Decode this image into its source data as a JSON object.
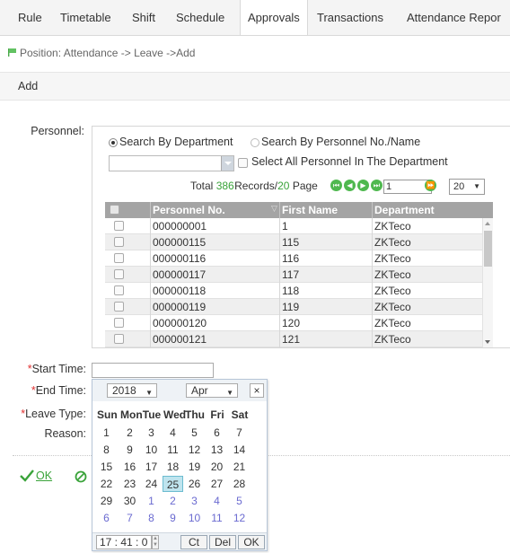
{
  "nav": {
    "tabs": [
      {
        "label": "Rule"
      },
      {
        "label": "Timetable"
      },
      {
        "label": "Shift"
      },
      {
        "label": "Schedule"
      },
      {
        "label": "Approvals",
        "active": true
      },
      {
        "label": "Transactions"
      },
      {
        "label": "Attendance Repor"
      }
    ]
  },
  "breadcrumb": "Position: Attendance -> Leave ->Add",
  "toolbar": {
    "title": "Add"
  },
  "form": {
    "personnel_label": "Personnel:",
    "search_by_department": "Search By Department",
    "search_by_personnel": "Search By Personnel No./Name",
    "select_all_label": "Select All Personnel In The Department",
    "department_value": "",
    "pager": {
      "total_prefix": "Total",
      "total": "386",
      "records_mid": "Records/",
      "pages": "20",
      "page_word": "Page",
      "current_page": "1",
      "page_size": "20"
    },
    "table": {
      "columns": [
        "",
        "Personnel No.",
        "First Name",
        "Department"
      ],
      "rows": [
        {
          "no": "000000001",
          "name": "1",
          "dept": "ZKTeco"
        },
        {
          "no": "000000115",
          "name": "115",
          "dept": "ZKTeco"
        },
        {
          "no": "000000116",
          "name": "116",
          "dept": "ZKTeco"
        },
        {
          "no": "000000117",
          "name": "117",
          "dept": "ZKTeco"
        },
        {
          "no": "000000118",
          "name": "118",
          "dept": "ZKTeco"
        },
        {
          "no": "000000119",
          "name": "119",
          "dept": "ZKTeco"
        },
        {
          "no": "000000120",
          "name": "120",
          "dept": "ZKTeco"
        },
        {
          "no": "000000121",
          "name": "121",
          "dept": "ZKTeco"
        }
      ]
    },
    "start_time_label": "Start Time:",
    "start_time_value": "",
    "end_time_label": "End Time:",
    "leave_type_label": "Leave Type:",
    "reason_label": "Reason:",
    "required_mark": "*"
  },
  "calendar": {
    "year": "2018",
    "month": "Apr",
    "close": "×",
    "weekdays": [
      "Sun",
      "Mon",
      "Tue",
      "Wed",
      "Thu",
      "Fri",
      "Sat"
    ],
    "weeks": [
      [
        {
          "d": "1"
        },
        {
          "d": "2"
        },
        {
          "d": "3"
        },
        {
          "d": "4"
        },
        {
          "d": "5"
        },
        {
          "d": "6"
        },
        {
          "d": "7"
        }
      ],
      [
        {
          "d": "8"
        },
        {
          "d": "9"
        },
        {
          "d": "10"
        },
        {
          "d": "11"
        },
        {
          "d": "12"
        },
        {
          "d": "13"
        },
        {
          "d": "14"
        }
      ],
      [
        {
          "d": "15"
        },
        {
          "d": "16"
        },
        {
          "d": "17"
        },
        {
          "d": "18"
        },
        {
          "d": "19"
        },
        {
          "d": "20"
        },
        {
          "d": "21"
        }
      ],
      [
        {
          "d": "22"
        },
        {
          "d": "23"
        },
        {
          "d": "24"
        },
        {
          "d": "25",
          "selected": true
        },
        {
          "d": "26"
        },
        {
          "d": "27"
        },
        {
          "d": "28"
        }
      ],
      [
        {
          "d": "29"
        },
        {
          "d": "30"
        },
        {
          "d": "1",
          "other": true
        },
        {
          "d": "2",
          "other": true
        },
        {
          "d": "3",
          "other": true
        },
        {
          "d": "4",
          "other": true
        },
        {
          "d": "5",
          "other": true
        }
      ],
      [
        {
          "d": "6",
          "other": true
        },
        {
          "d": "7",
          "other": true
        },
        {
          "d": "8",
          "other": true
        },
        {
          "d": "9",
          "other": true
        },
        {
          "d": "10",
          "other": true
        },
        {
          "d": "11",
          "other": true
        },
        {
          "d": "12",
          "other": true
        }
      ]
    ],
    "time": "17 : 41 : 0",
    "buttons": {
      "current": "Ct",
      "delete": "Del",
      "ok": "OK"
    }
  },
  "actions": {
    "ok_label": "OK"
  },
  "colors": {
    "accent_green": "#3aa33a",
    "required_red": "#e03030",
    "selected_day": "#bfe4ee"
  }
}
